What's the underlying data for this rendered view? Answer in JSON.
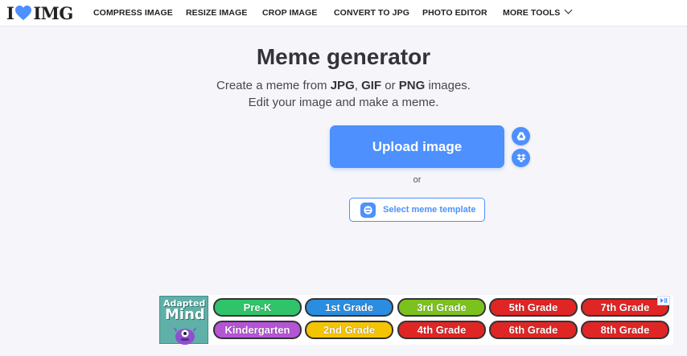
{
  "header": {
    "logo": {
      "left": "I",
      "right": "IMG"
    },
    "nav": [
      {
        "label": "COMPRESS IMAGE"
      },
      {
        "label": "RESIZE IMAGE"
      },
      {
        "label": "CROP IMAGE"
      },
      {
        "label": "CONVERT TO JPG"
      },
      {
        "label": "PHOTO EDITOR"
      },
      {
        "label": "MORE TOOLS"
      }
    ]
  },
  "main": {
    "title": "Meme generator",
    "subtitle": {
      "prefix": "Create a meme from ",
      "fmt1": "JPG",
      "sep1": ", ",
      "fmt2": "GIF",
      "sep2": " or ",
      "fmt3": "PNG",
      "suffix": " images.",
      "line2": "Edit your image and make a meme."
    },
    "upload_label": "Upload image",
    "or_label": "or",
    "template_label": "Select meme template"
  },
  "ad": {
    "logo_line1": "Adapted",
    "logo_line2": "Mind",
    "grades": [
      {
        "label": "Pre-K",
        "color": "#2fc46a"
      },
      {
        "label": "1st Grade",
        "color": "#2a8de0"
      },
      {
        "label": "3rd Grade",
        "color": "#7cc21f"
      },
      {
        "label": "5th Grade",
        "color": "#e02525"
      },
      {
        "label": "7th Grade",
        "color": "#e02525"
      },
      {
        "label": "Kindergarten",
        "color": "#b654d6"
      },
      {
        "label": "2nd Grade",
        "color": "#f5c400"
      },
      {
        "label": "4th Grade",
        "color": "#e02525"
      },
      {
        "label": "6th Grade",
        "color": "#e02525"
      },
      {
        "label": "8th Grade",
        "color": "#e02525"
      }
    ]
  },
  "colors": {
    "accent": "#4d90fe",
    "heart": "#4d90fe",
    "background": "#f5f5fa"
  }
}
